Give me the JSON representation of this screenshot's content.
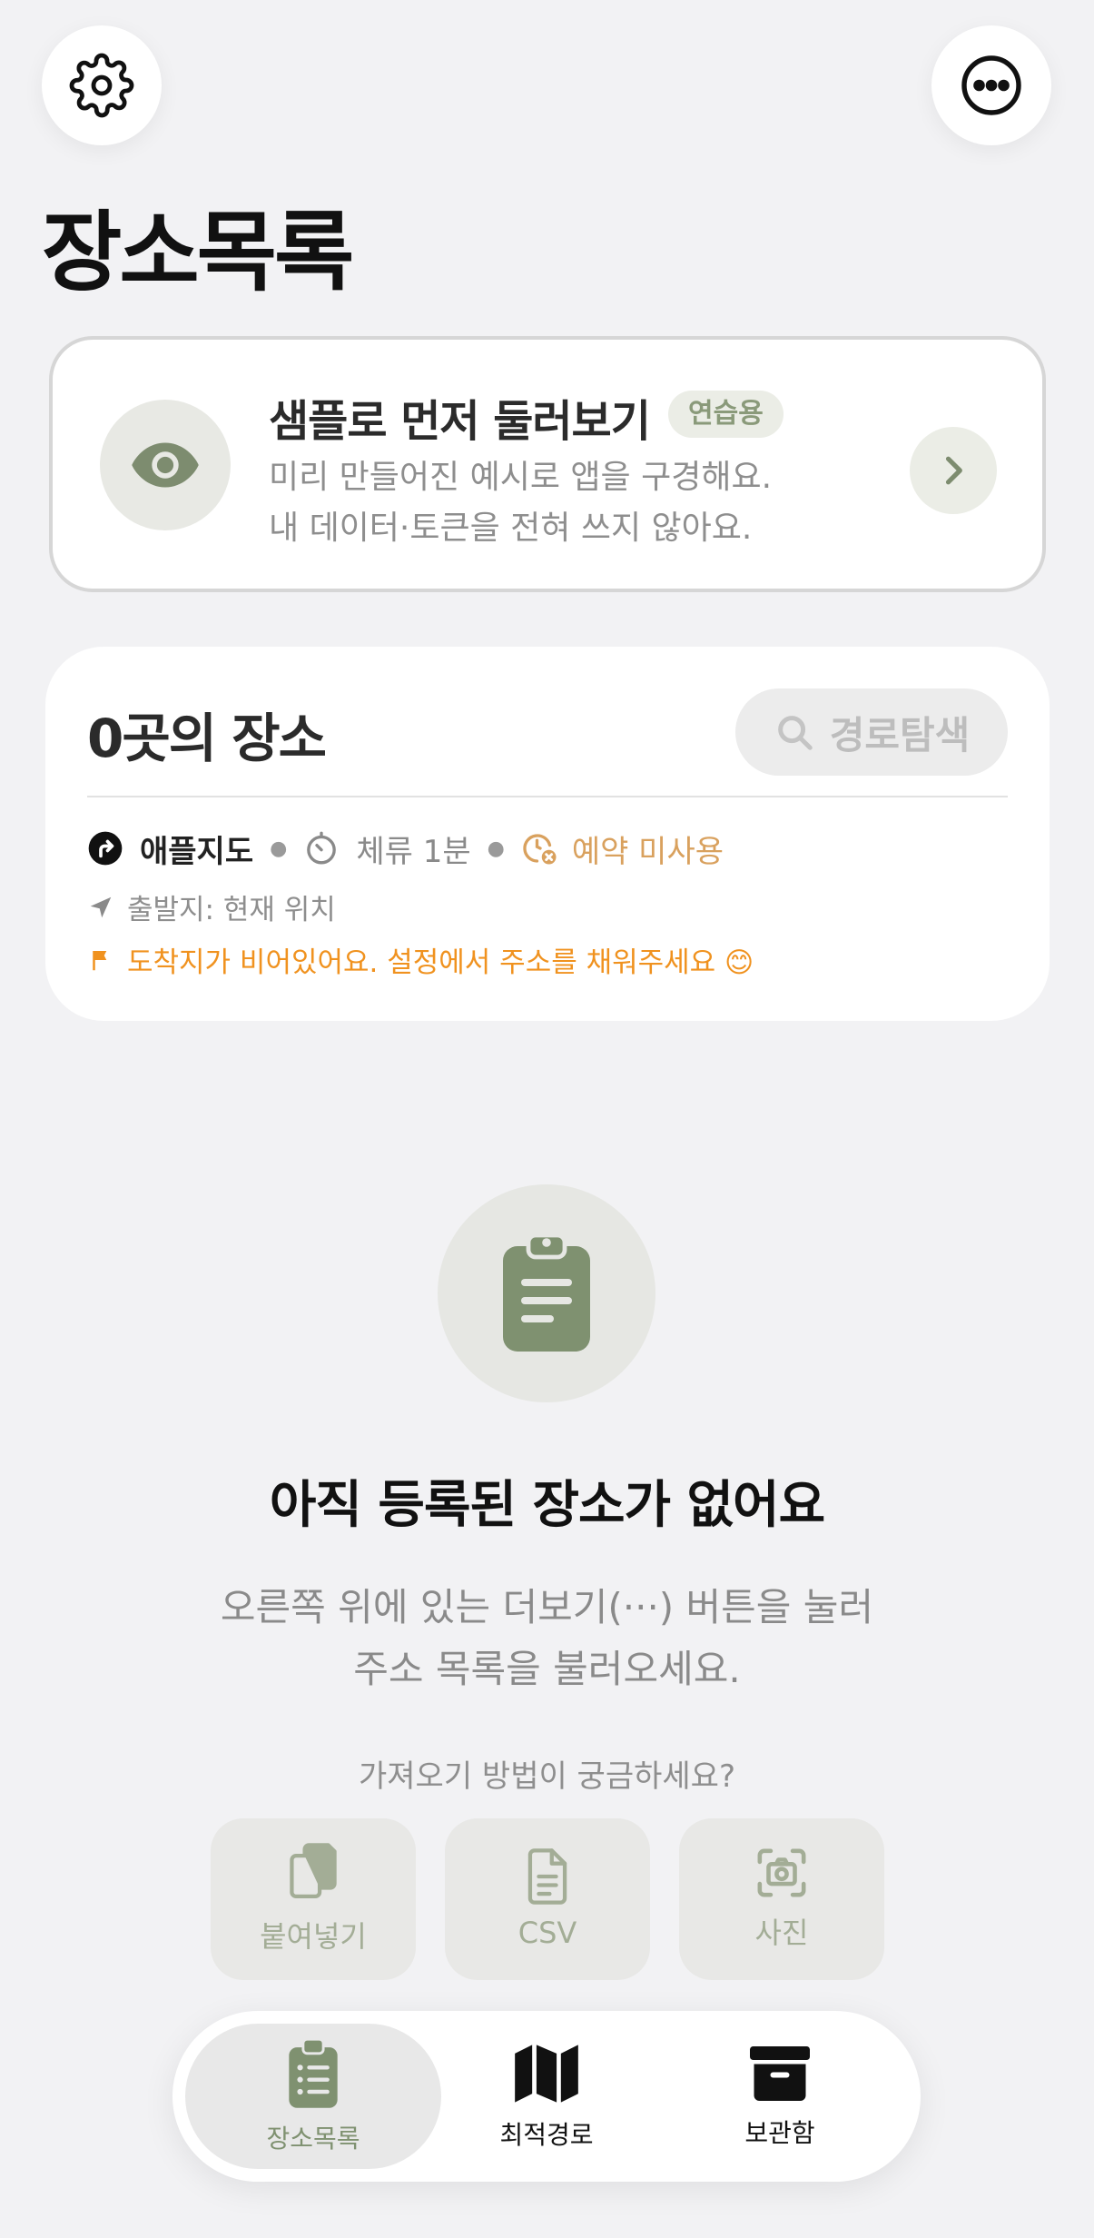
{
  "page": {
    "title": "장소목록"
  },
  "sample": {
    "title": "샘플로 먼저 둘러보기",
    "badge": "연습용",
    "desc_line1": "미리 만들어진 예시로 앱을 구경해요.",
    "desc_line2": "내 데이터·토큰을 전혀 쓰지 않아요."
  },
  "places": {
    "count_label": "0곳의 장소",
    "route_button": "경로탐색",
    "map_app": "애플지도",
    "stay_time": "체류 1분",
    "reservation": "예약 미사용",
    "origin": "출발지: 현재 위치",
    "destination_warning": "도착지가 비어있어요. 설정에서 주소를 채워주세요 😊"
  },
  "empty": {
    "title": "아직 등록된 장소가 없어요",
    "desc_line1": "오른쪽 위에 있는 더보기(···) 버튼을 눌러",
    "desc_line2": "주소 목록을 불러오세요.",
    "how_text": "가져오기 방법이 궁금하세요?",
    "methods": [
      {
        "label": "붙여넣기",
        "icon": "paste-icon"
      },
      {
        "label": "CSV",
        "icon": "document-icon"
      },
      {
        "label": "사진",
        "icon": "camera-icon"
      }
    ]
  },
  "tabs": [
    {
      "label": "장소목록",
      "icon": "clipboard-icon",
      "active": true
    },
    {
      "label": "최적경로",
      "icon": "map-icon",
      "active": false
    },
    {
      "label": "보관함",
      "icon": "archive-icon",
      "active": false
    }
  ],
  "colors": {
    "accent_green": "#7f9170",
    "warning_orange": "#f0921f",
    "reservation_orange": "#d9a15e",
    "background": "#f2f2f4"
  }
}
